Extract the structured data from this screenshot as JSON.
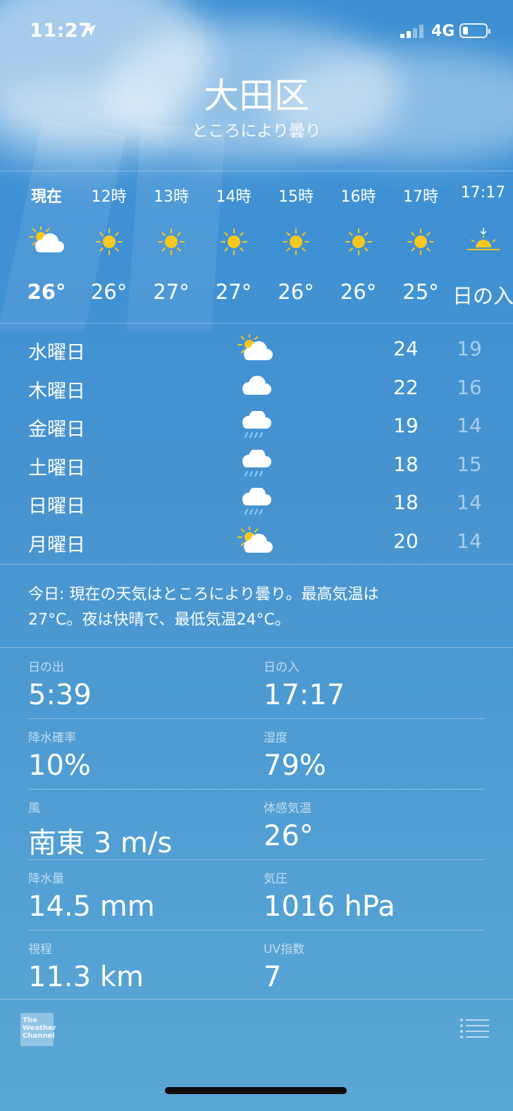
{
  "status_bar": {
    "time": "11:27",
    "network": "4G"
  },
  "header": {
    "location": "大田区",
    "condition": "ところにより曇り"
  },
  "hourly": [
    {
      "label": "現在",
      "icon": "sun-cloud-icon",
      "temp": "26°",
      "now": true
    },
    {
      "label": "12時",
      "icon": "sun-icon",
      "temp": "26°"
    },
    {
      "label": "13時",
      "icon": "sun-icon",
      "temp": "27°"
    },
    {
      "label": "14時",
      "icon": "sun-icon",
      "temp": "27°"
    },
    {
      "label": "15時",
      "icon": "sun-icon",
      "temp": "26°"
    },
    {
      "label": "16時",
      "icon": "sun-icon",
      "temp": "26°"
    },
    {
      "label": "17時",
      "icon": "sun-icon",
      "temp": "25°"
    },
    {
      "label": "17:17",
      "icon": "sunset-icon",
      "temp": "日の入"
    }
  ],
  "daily": [
    {
      "day": "水曜日",
      "icon": "sun-cloud-icon",
      "high": "24",
      "low": "19"
    },
    {
      "day": "木曜日",
      "icon": "cloud-icon",
      "high": "22",
      "low": "16"
    },
    {
      "day": "金曜日",
      "icon": "rain-cloud-icon",
      "high": "19",
      "low": "14"
    },
    {
      "day": "土曜日",
      "icon": "rain-cloud-icon",
      "high": "18",
      "low": "15"
    },
    {
      "day": "日曜日",
      "icon": "rain-cloud-icon",
      "high": "18",
      "low": "14"
    },
    {
      "day": "月曜日",
      "icon": "sun-cloud-icon",
      "high": "20",
      "low": "14"
    }
  ],
  "summary": {
    "line1": "今日: 現在の天気はところにより曇り。最高気温は",
    "line2": "27°C。夜は快晴で、最低気温24°C。"
  },
  "details": [
    {
      "left": {
        "label": "日の出",
        "value": "5:39"
      },
      "right": {
        "label": "日の入",
        "value": "17:17"
      }
    },
    {
      "left": {
        "label": "降水確率",
        "value": "10%"
      },
      "right": {
        "label": "湿度",
        "value": "79%"
      }
    },
    {
      "left": {
        "label": "風",
        "value": "南東 3 m/s"
      },
      "right": {
        "label": "体感気温",
        "value": "26°"
      }
    },
    {
      "left": {
        "label": "降水量",
        "value": "14.5 mm"
      },
      "right": {
        "label": "気圧",
        "value": "1016 hPa"
      }
    },
    {
      "left": {
        "label": "視程",
        "value": "11.3 km"
      },
      "right": {
        "label": "UV指数",
        "value": "7"
      }
    }
  ],
  "footer": {
    "logo_line1": "The",
    "logo_line2": "Weather",
    "logo_line3": "Channel"
  },
  "colors": {
    "sun": "#f7c81e",
    "cloud": "#ffffff",
    "rain": "#8ad0ff",
    "sky_top": "#3d8fd2",
    "sky_bottom": "#5aa7d5"
  }
}
